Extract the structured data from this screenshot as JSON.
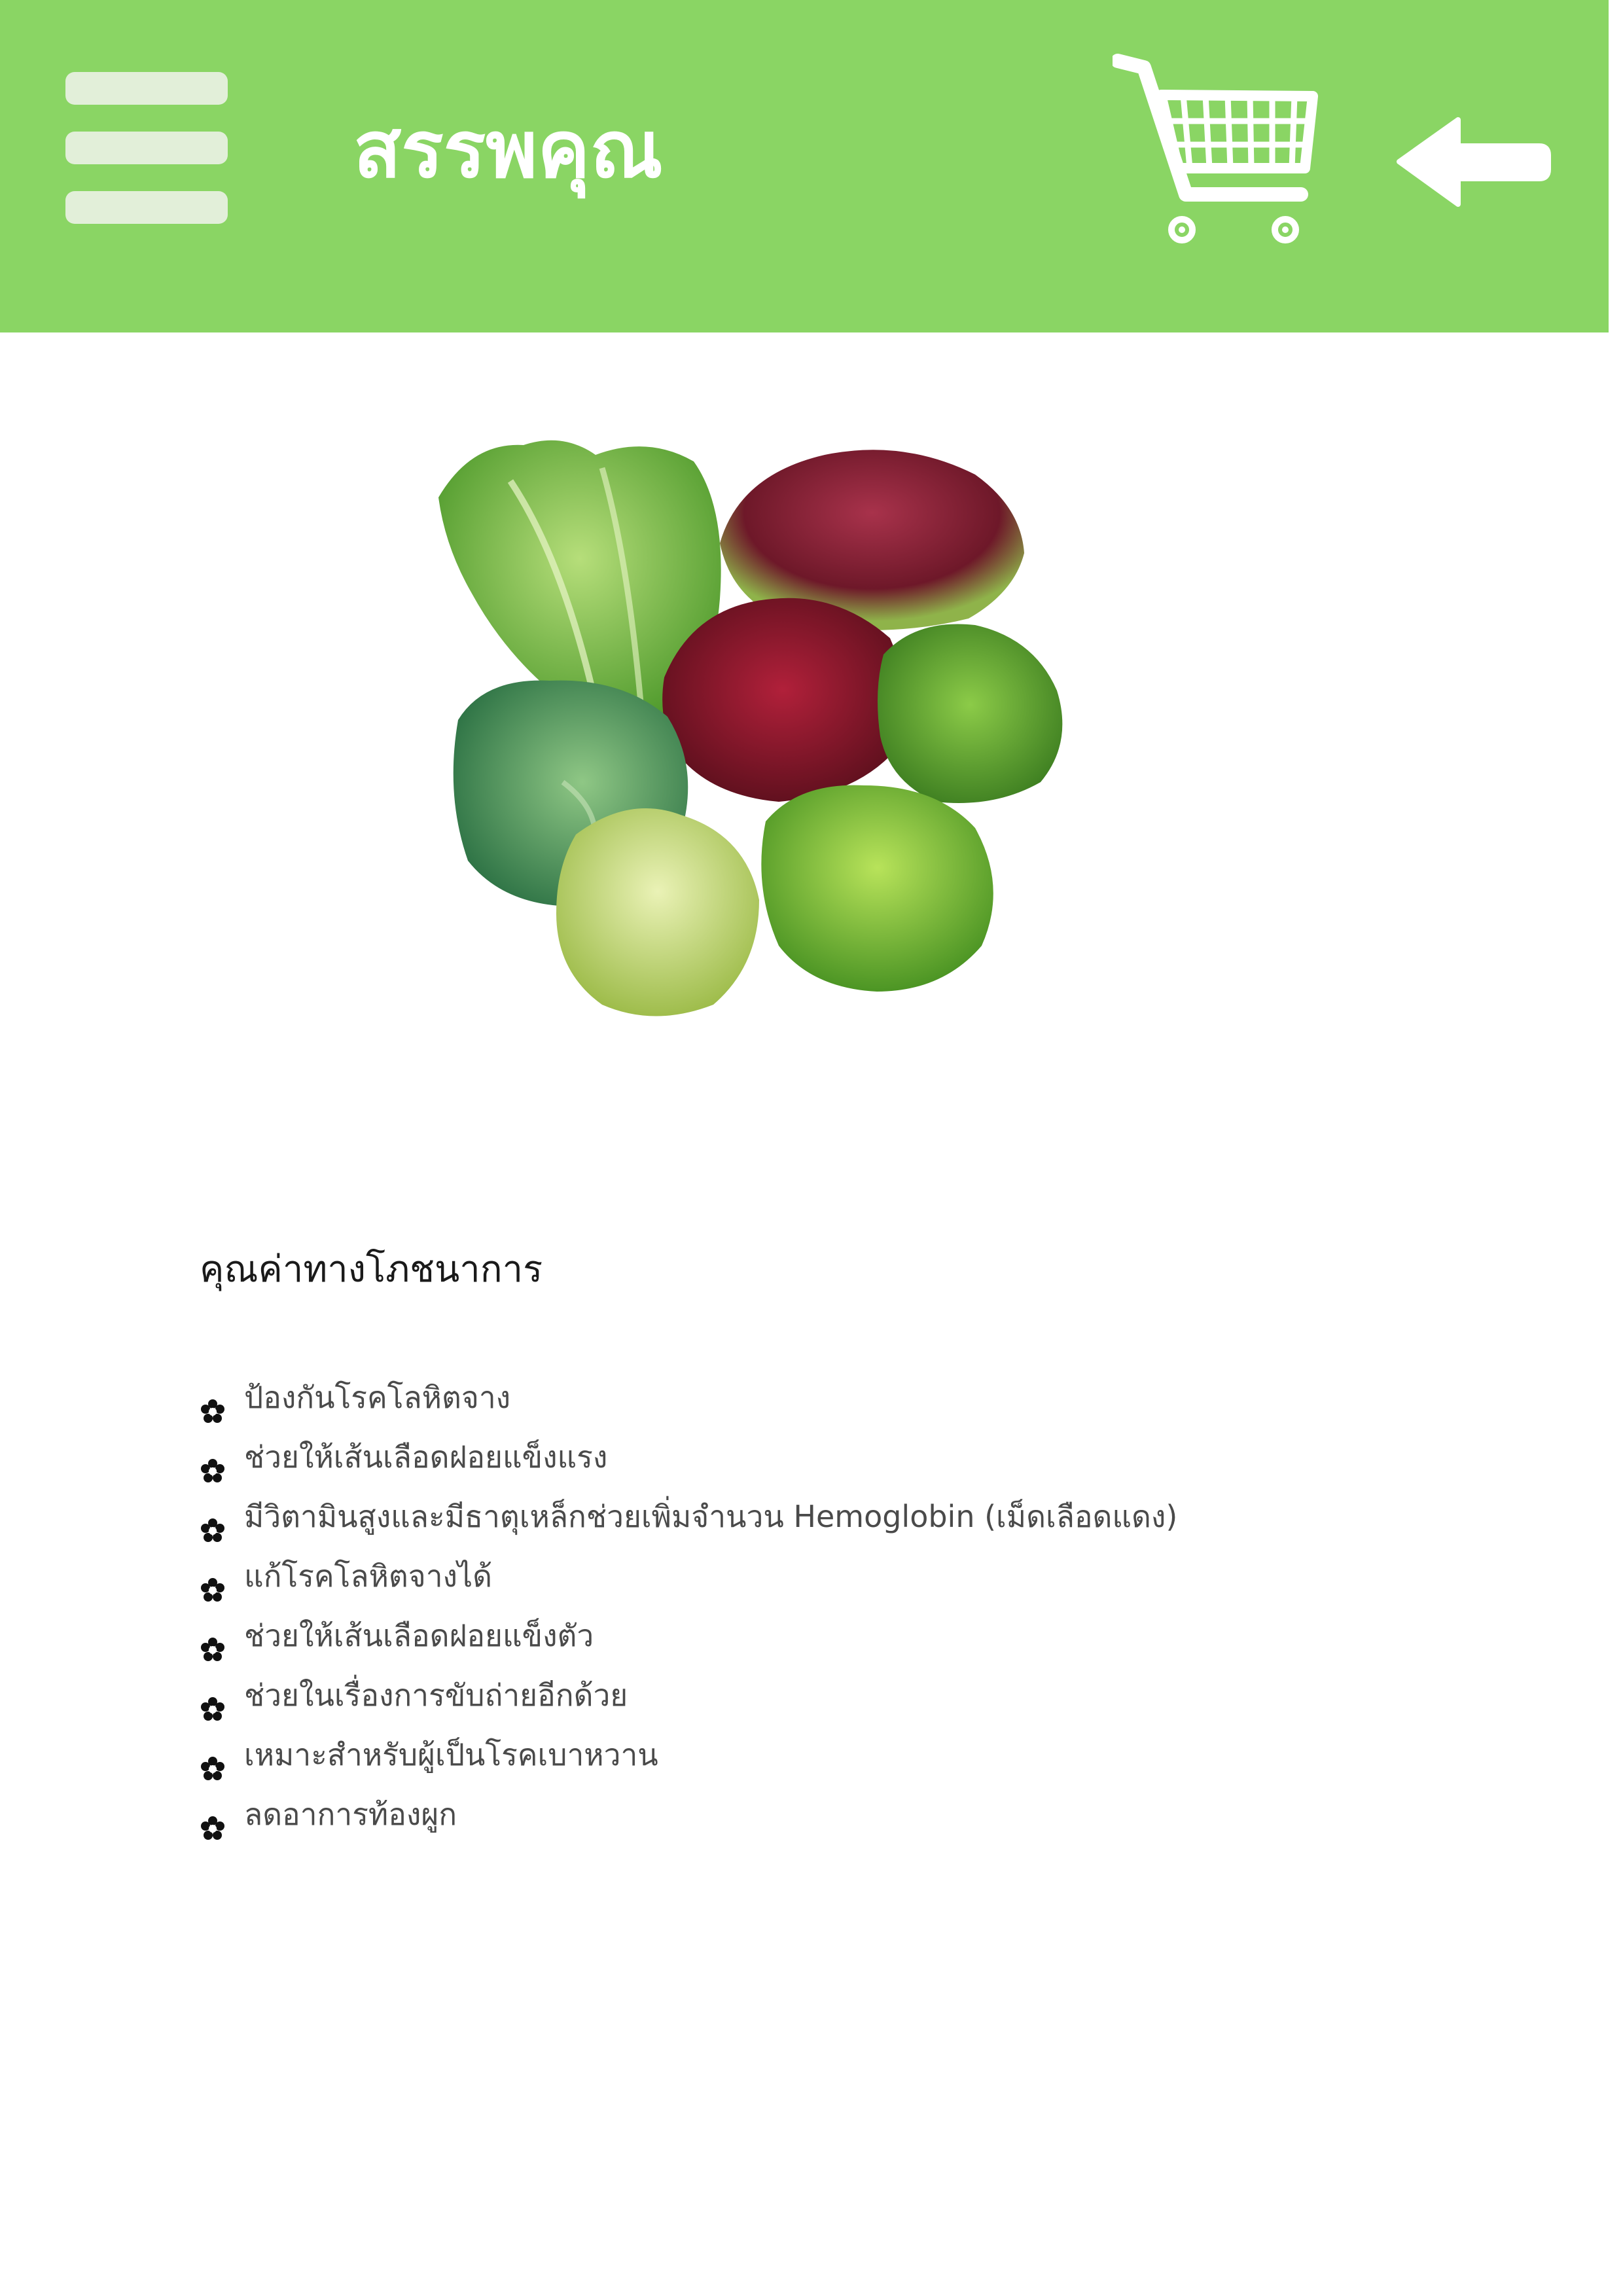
{
  "theme": {
    "accent": "#8ad564",
    "menu_bar_color": "#e2efd9"
  },
  "header": {
    "title": "สรรพคุณ",
    "menu_icon": "hamburger-menu-icon",
    "cart_icon": "shopping-cart-icon",
    "back_icon": "arrow-left-icon"
  },
  "product": {
    "image_icon": "lettuce-varieties-image"
  },
  "nutrition": {
    "heading": "คุณค่าทางโภชนาการ",
    "bullet_icon": "flower-bullet-icon",
    "items": [
      "ป้องกันโรคโลหิตจาง",
      "ช่วยให้เส้นเลือดฝอยแข็งแรง",
      "มีวิตามินสูงและมีธาตุเหล็กช่วยเพิ่มจำนวน Hemoglobin (เม็ดเลือดแดง)",
      "แก้โรคโลหิตจางได้",
      "ช่วยให้เส้นเลือดฝอยแข็งตัว",
      "ช่วยในเรื่องการขับถ่ายอีกด้วย",
      "เหมาะสำหรับผู้เป็นโรคเบาหวาน",
      "ลดอาการท้องผูก"
    ]
  }
}
